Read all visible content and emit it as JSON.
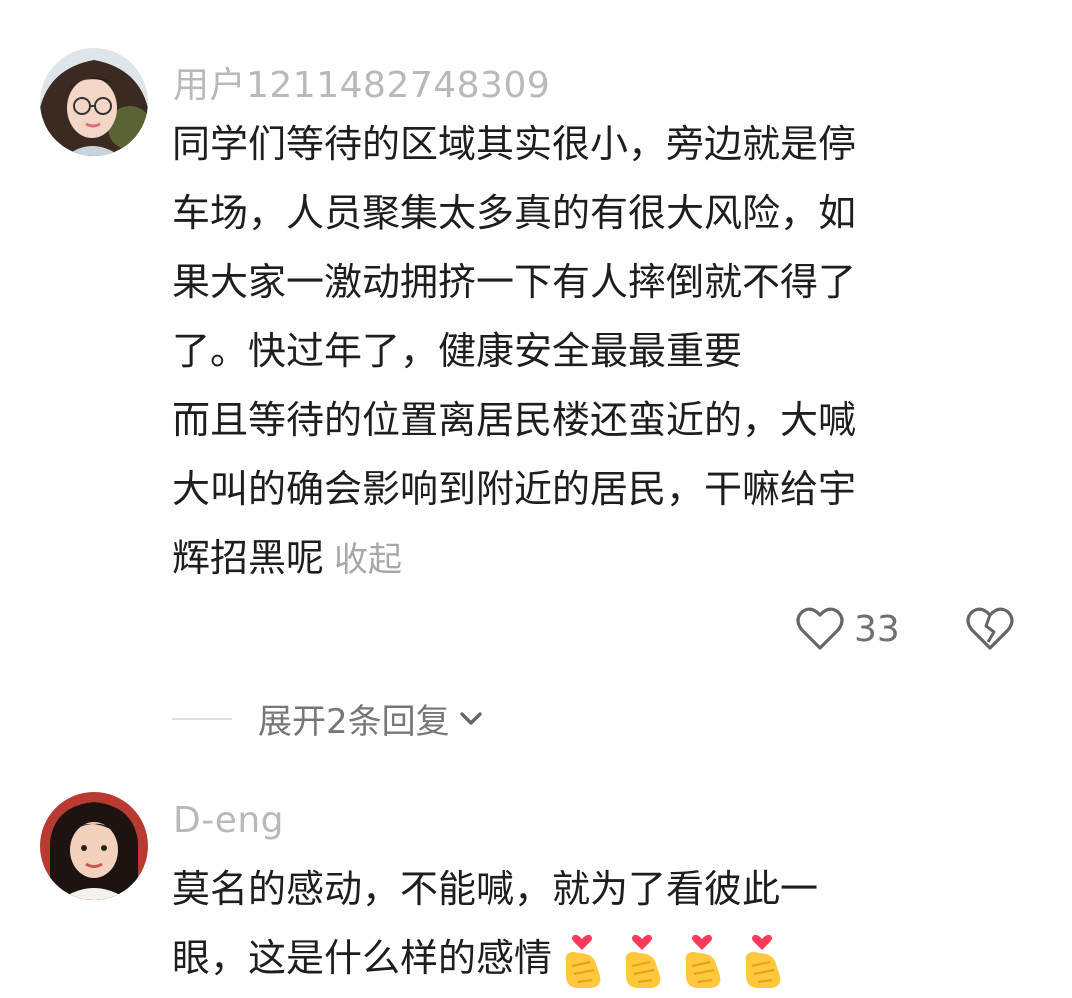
{
  "comments": [
    {
      "username": "用户1211482748309",
      "avatar_icon": "avatar-woman-glasses",
      "lines": [
        "同学们等待的区域其实很小，旁边就是停",
        "车场，人员聚集太多真的有很大风险，如",
        "果大家一激动拥挤一下有人摔倒就不得了",
        "了。快过年了，健康安全最最重要",
        "而且等待的位置离居民楼还蛮近的，大喊",
        "大叫的确会影响到附近的居民，干嘛给宇",
        "辉招黑呢"
      ],
      "collapse_label": "收起",
      "like_count": "33",
      "like_icon": "heart-outline-icon",
      "dislike_icon": "broken-heart-icon",
      "replies_label": "展开2条回复",
      "replies_icon": "chevron-down-icon"
    },
    {
      "username": "D-eng",
      "avatar_icon": "avatar-woman-portrait",
      "lines": [
        "莫名的感动，不能喊，就为了看彼此一",
        "眼，这是什么样的感情"
      ],
      "emoji": [
        "finger-heart-emoji",
        "finger-heart-emoji",
        "finger-heart-emoji",
        "finger-heart-emoji"
      ]
    }
  ],
  "colors": {
    "username": "#b9b9b9",
    "text": "#1e1e1e",
    "muted": "#a8a8a8",
    "emoji_heart": "#ff3b5c",
    "emoji_hand": "#ffc83d"
  }
}
